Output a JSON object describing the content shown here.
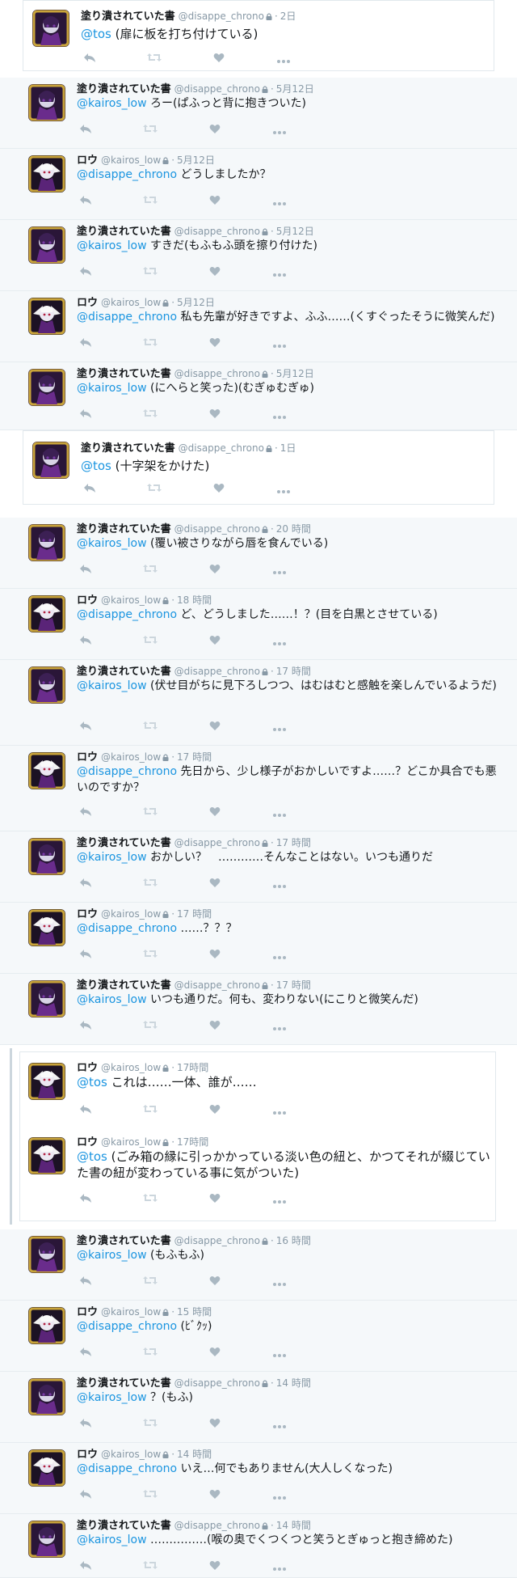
{
  "colors": {
    "mention": "#1b95e0",
    "meta": "#8899a6",
    "bg": "#f5f8fa",
    "border": "#e6ecf0",
    "icon": "#aab8c2"
  },
  "icons": {
    "reply": "reply-icon",
    "retweet": "retweet-icon",
    "like": "heart-icon",
    "more": "more-icon",
    "lock": "lock-icon"
  },
  "tweets": [
    {
      "name": "塗り潰されていた書",
      "handle": "@disappe_chrono",
      "time": "2日",
      "mention": "@tos",
      "body": " (扉に板を打ち付けている)",
      "avatar": "purple"
    },
    {
      "name": "塗り潰されていた書",
      "handle": "@disappe_chrono",
      "time": "5月12日",
      "mention": "@kairos_low",
      "body": " ろー(ぱふっと背に抱きついた)",
      "avatar": "purple"
    },
    {
      "name": "ロウ",
      "handle": "@kairos_low",
      "time": "5月12日",
      "mention": "@disappe_chrono",
      "body": " どうしましたか？",
      "avatar": "white"
    },
    {
      "name": "塗り潰されていた書",
      "handle": "@disappe_chrono",
      "time": "5月12日",
      "mention": "@kairos_low",
      "body": " すきだ(もふもふ頭を擦り付けた)",
      "avatar": "purple"
    },
    {
      "name": "ロウ",
      "handle": "@kairos_low",
      "time": "5月12日",
      "mention": "@disappe_chrono",
      "body": " 私も先輩が好きですよ、ふふ……(くすぐったそうに微笑んだ)",
      "avatar": "white"
    },
    {
      "name": "塗り潰されていた書",
      "handle": "@disappe_chrono",
      "time": "5月12日",
      "mention": "@kairos_low",
      "body": " (にへらと笑った)(むぎゅむぎゅ)",
      "avatar": "purple"
    },
    {
      "name": "塗り潰されていた書",
      "handle": "@disappe_chrono",
      "time": "1日",
      "mention": "@tos",
      "body": " (十字架をかけた)",
      "avatar": "purple"
    },
    {
      "name": "塗り潰されていた書",
      "handle": "@disappe_chrono",
      "time": "20 時間",
      "mention": "@kairos_low",
      "body": " (覆い被さりながら唇を食んでいる)",
      "avatar": "purple"
    },
    {
      "name": "ロウ",
      "handle": "@kairos_low",
      "time": "18 時間",
      "mention": "@disappe_chrono",
      "body": " ど、どうしました……！？(目を白黒とさせている)",
      "avatar": "white"
    },
    {
      "name": "塗り潰されていた書",
      "handle": "@disappe_chrono",
      "time": "17 時間",
      "mention": "@kairos_low",
      "body": " (伏せ目がちに見下ろしつつ、はむはむと感触を楽しんでいるようだ)",
      "avatar": "purple"
    },
    {
      "name": "ロウ",
      "handle": "@kairos_low",
      "time": "17 時間",
      "mention": "@disappe_chrono",
      "body": " 先日から、少し様子がおかしいですよ……？どこか具合でも悪いのですか？",
      "avatar": "white"
    },
    {
      "name": "塗り潰されていた書",
      "handle": "@disappe_chrono",
      "time": "17 時間",
      "mention": "@kairos_low",
      "body": " おかしい？　…………そんなことはない。いつも通りだ",
      "avatar": "purple"
    },
    {
      "name": "ロウ",
      "handle": "@kairos_low",
      "time": "17 時間",
      "mention": "@disappe_chrono",
      "body": " ……？？？",
      "avatar": "white"
    },
    {
      "name": "塗り潰されていた書",
      "handle": "@disappe_chrono",
      "time": "17 時間",
      "mention": "@kairos_low",
      "body": " いつも通りだ。何も、変わりない(にこりと微笑んだ)",
      "avatar": "purple"
    },
    {
      "name": "ロウ",
      "handle": "@kairos_low",
      "time": "17時間",
      "mention": "@tos",
      "body": " これは……一体、誰が……",
      "avatar": "white"
    },
    {
      "name": "ロウ",
      "handle": "@kairos_low",
      "time": "17時間",
      "mention": "@tos",
      "body": " (ごみ箱の縁に引っかかっている淡い色の紐と、かつてそれが綴じていた書の紐が変わっている事に気がついた)",
      "avatar": "white"
    },
    {
      "name": "塗り潰されていた書",
      "handle": "@disappe_chrono",
      "time": "16 時間",
      "mention": "@kairos_low",
      "body": " (もふもふ)",
      "avatar": "purple"
    },
    {
      "name": "ロウ",
      "handle": "@kairos_low",
      "time": "15 時間",
      "mention": "@disappe_chrono",
      "body": " (ﾋﾞｸｯ)",
      "avatar": "white"
    },
    {
      "name": "塗り潰されていた書",
      "handle": "@disappe_chrono",
      "time": "14 時間",
      "mention": "@kairos_low",
      "body": " ？(もふ)",
      "avatar": "purple"
    },
    {
      "name": "ロウ",
      "handle": "@kairos_low",
      "time": "14 時間",
      "mention": "@disappe_chrono",
      "body": " いえ…何でもありません(大人しくなった)",
      "avatar": "white"
    },
    {
      "name": "塗り潰されていた書",
      "handle": "@disappe_chrono",
      "time": "14 時間",
      "mention": "@kairos_low",
      "body": " ……………(喉の奥でくつくつと笑うとぎゅっと抱き締めた)",
      "avatar": "purple"
    }
  ]
}
